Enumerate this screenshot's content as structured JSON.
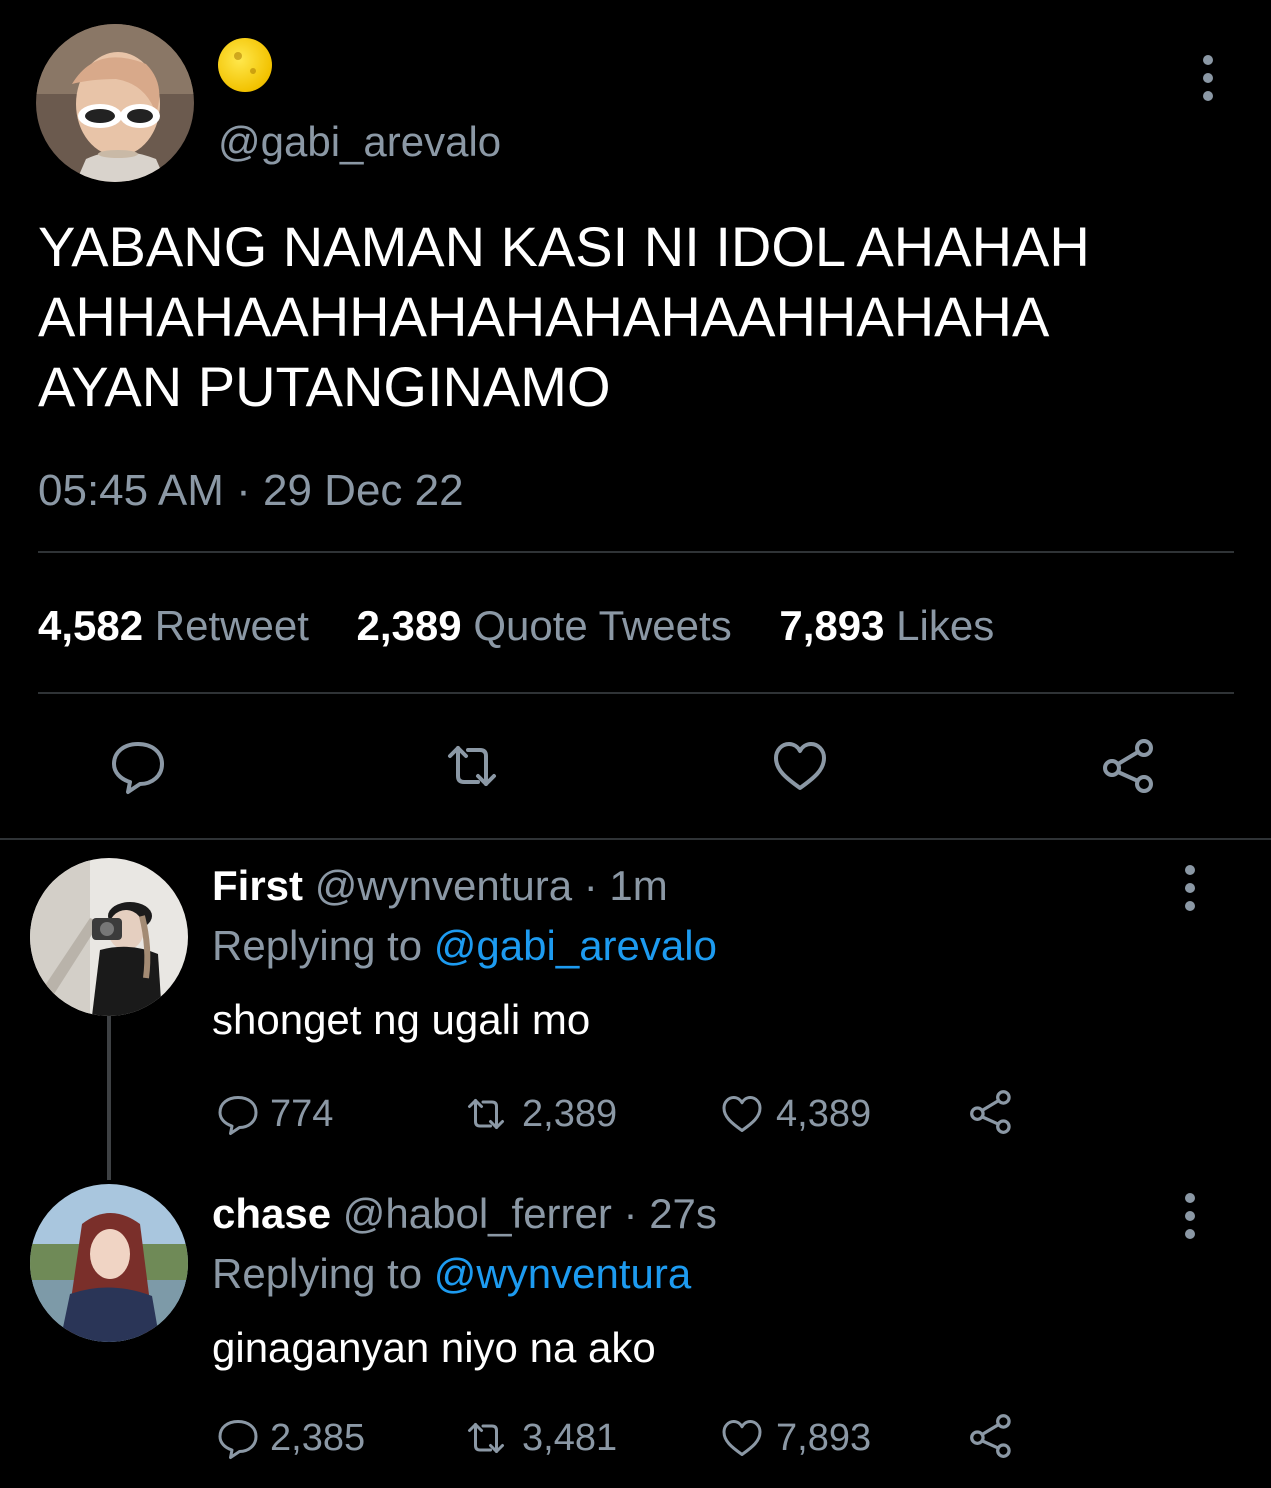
{
  "main_tweet": {
    "handle": "@gabi_arevalo",
    "display_name_emoji": "moon-face-emoji",
    "text": "YABANG NAMAN KASI NI IDOL AHAHAH\nAHHAHAAHHAHAHAHAHAAHHAHAHA\nAYAN PUTANGINAMO",
    "timestamp": "05:45 AM · 29 Dec 22",
    "stats": {
      "retweets_count": "4,582",
      "retweets_label": "Retweet",
      "quotes_count": "2,389",
      "quotes_label": "Quote Tweets",
      "likes_count": "7,893",
      "likes_label": "Likes"
    },
    "actions": [
      "reply-icon",
      "retweet-icon",
      "like-icon",
      "share-icon"
    ]
  },
  "replies": [
    {
      "name": "First",
      "handle": "@wynventura",
      "time": "· 1m",
      "replying_prefix": "Replying to",
      "replying_to": "@gabi_arevalo",
      "text": "shonget ng ugali mo",
      "reply_count": "774",
      "retweet_count": "2,389",
      "like_count": "4,389"
    },
    {
      "name": "chase",
      "handle": "@habol_ferrer",
      "time": "· 27s",
      "replying_prefix": "Replying to",
      "replying_to": "@wynventura",
      "text": "ginaganyan niyo na ako",
      "reply_count": "2,385",
      "retweet_count": "3,481",
      "like_count": "7,893"
    }
  ],
  "colors": {
    "background": "#000000",
    "text": "#e7e9ea",
    "secondary": "#8b98a5",
    "accent": "#1d9bf0",
    "divider": "#2f3336"
  }
}
